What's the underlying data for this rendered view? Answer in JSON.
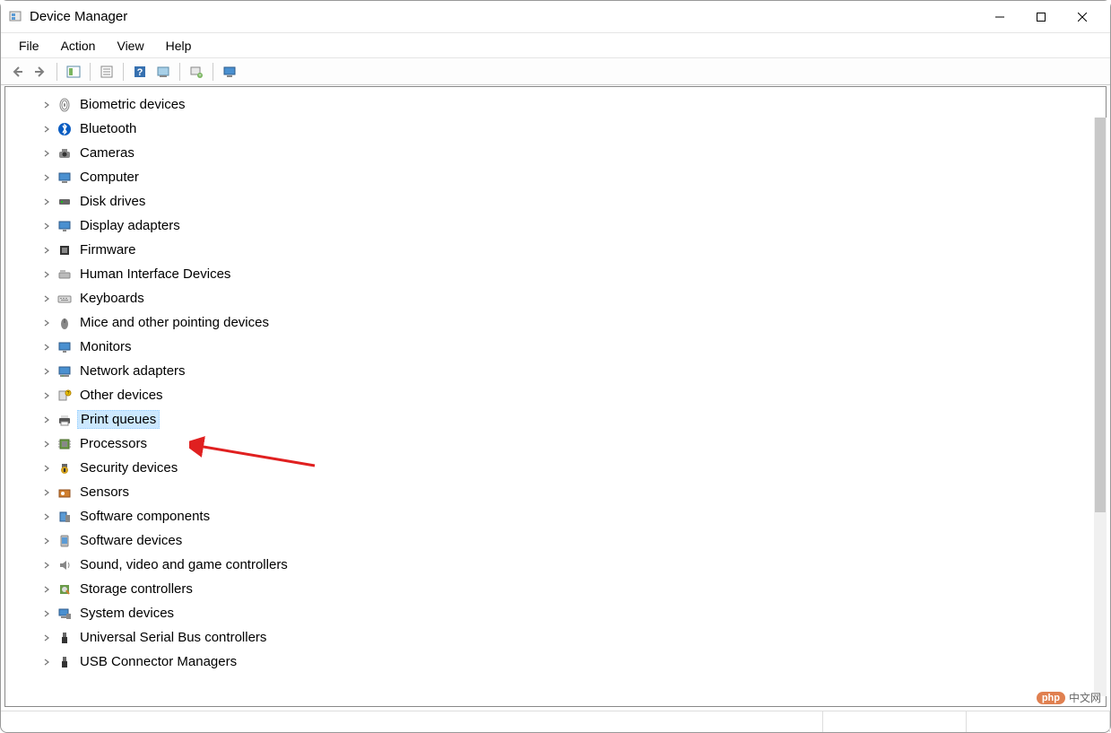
{
  "window": {
    "title": "Device Manager"
  },
  "menu": {
    "file": "File",
    "action": "Action",
    "view": "View",
    "help": "Help"
  },
  "tree": {
    "items": [
      {
        "label": "Biometric devices",
        "icon": "fingerprint",
        "selected": false
      },
      {
        "label": "Bluetooth",
        "icon": "bluetooth",
        "selected": false
      },
      {
        "label": "Cameras",
        "icon": "camera",
        "selected": false
      },
      {
        "label": "Computer",
        "icon": "computer",
        "selected": false
      },
      {
        "label": "Disk drives",
        "icon": "disk",
        "selected": false
      },
      {
        "label": "Display adapters",
        "icon": "display",
        "selected": false
      },
      {
        "label": "Firmware",
        "icon": "firmware",
        "selected": false
      },
      {
        "label": "Human Interface Devices",
        "icon": "hid",
        "selected": false
      },
      {
        "label": "Keyboards",
        "icon": "keyboard",
        "selected": false
      },
      {
        "label": "Mice and other pointing devices",
        "icon": "mouse",
        "selected": false
      },
      {
        "label": "Monitors",
        "icon": "monitor",
        "selected": false
      },
      {
        "label": "Network adapters",
        "icon": "network",
        "selected": false
      },
      {
        "label": "Other devices",
        "icon": "other",
        "selected": false
      },
      {
        "label": "Print queues",
        "icon": "printer",
        "selected": true
      },
      {
        "label": "Processors",
        "icon": "cpu",
        "selected": false
      },
      {
        "label": "Security devices",
        "icon": "security",
        "selected": false
      },
      {
        "label": "Sensors",
        "icon": "sensors",
        "selected": false
      },
      {
        "label": "Software components",
        "icon": "softcomp",
        "selected": false
      },
      {
        "label": "Software devices",
        "icon": "softdev",
        "selected": false
      },
      {
        "label": "Sound, video and game controllers",
        "icon": "sound",
        "selected": false
      },
      {
        "label": "Storage controllers",
        "icon": "storage",
        "selected": false
      },
      {
        "label": "System devices",
        "icon": "system",
        "selected": false
      },
      {
        "label": "Universal Serial Bus controllers",
        "icon": "usb",
        "selected": false
      },
      {
        "label": "USB Connector Managers",
        "icon": "usbconn",
        "selected": false
      }
    ]
  },
  "watermark": {
    "badge": "php",
    "text": "中文网"
  }
}
